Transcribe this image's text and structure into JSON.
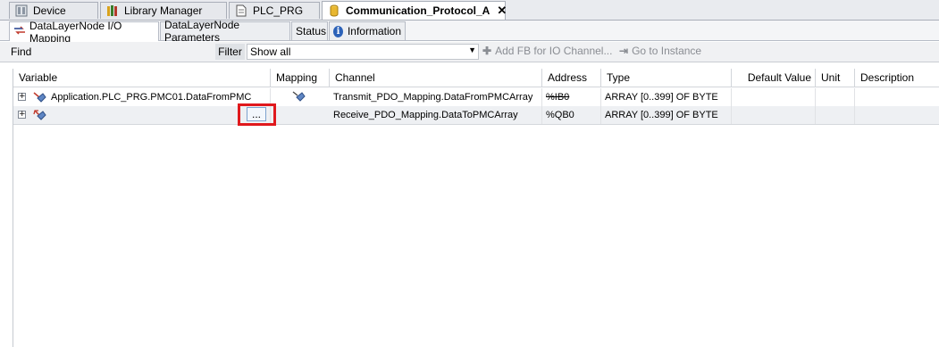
{
  "doc_tabs": [
    {
      "label": "Device",
      "icon": "device-icon"
    },
    {
      "label": "Library Manager",
      "icon": "library-icon"
    },
    {
      "label": "PLC_PRG",
      "icon": "document-icon"
    },
    {
      "label": "Communication_Protocol_A",
      "icon": "cylinder-icon",
      "close": "✕"
    }
  ],
  "sub_tabs": [
    {
      "label": "DataLayerNode I/O Mapping",
      "icon": "io-mapping-icon"
    },
    {
      "label": "DataLayerNode Parameters"
    },
    {
      "label": "Status"
    },
    {
      "label": "Information",
      "icon": "info-icon"
    }
  ],
  "toolbar": {
    "find_label": "Find",
    "filter_label": "Filter",
    "filter_value": "Show all",
    "add_fb_label": "Add FB for IO Channel...",
    "goto_label": "Go to Instance"
  },
  "columns": [
    "Variable",
    "Mapping",
    "Channel",
    "Address",
    "Type",
    "Default Value",
    "Unit",
    "Description"
  ],
  "rows": [
    {
      "variable": "Application.PLC_PRG.PMC01.DataFromPMC",
      "channel": "Transmit_PDO_Mapping.DataFromPMCArray",
      "address": "%IB0",
      "address_struck": true,
      "type": "ARRAY [0..399] OF BYTE"
    },
    {
      "variable": "",
      "channel": "Receive_PDO_Mapping.DataToPMCArray",
      "address": "%QB0",
      "address_struck": false,
      "type": "ARRAY [0..399] OF BYTE"
    }
  ],
  "mapping_button_label": "...",
  "colors": {
    "highlight": "#e0191d",
    "row_alt": "#eef0f3"
  }
}
